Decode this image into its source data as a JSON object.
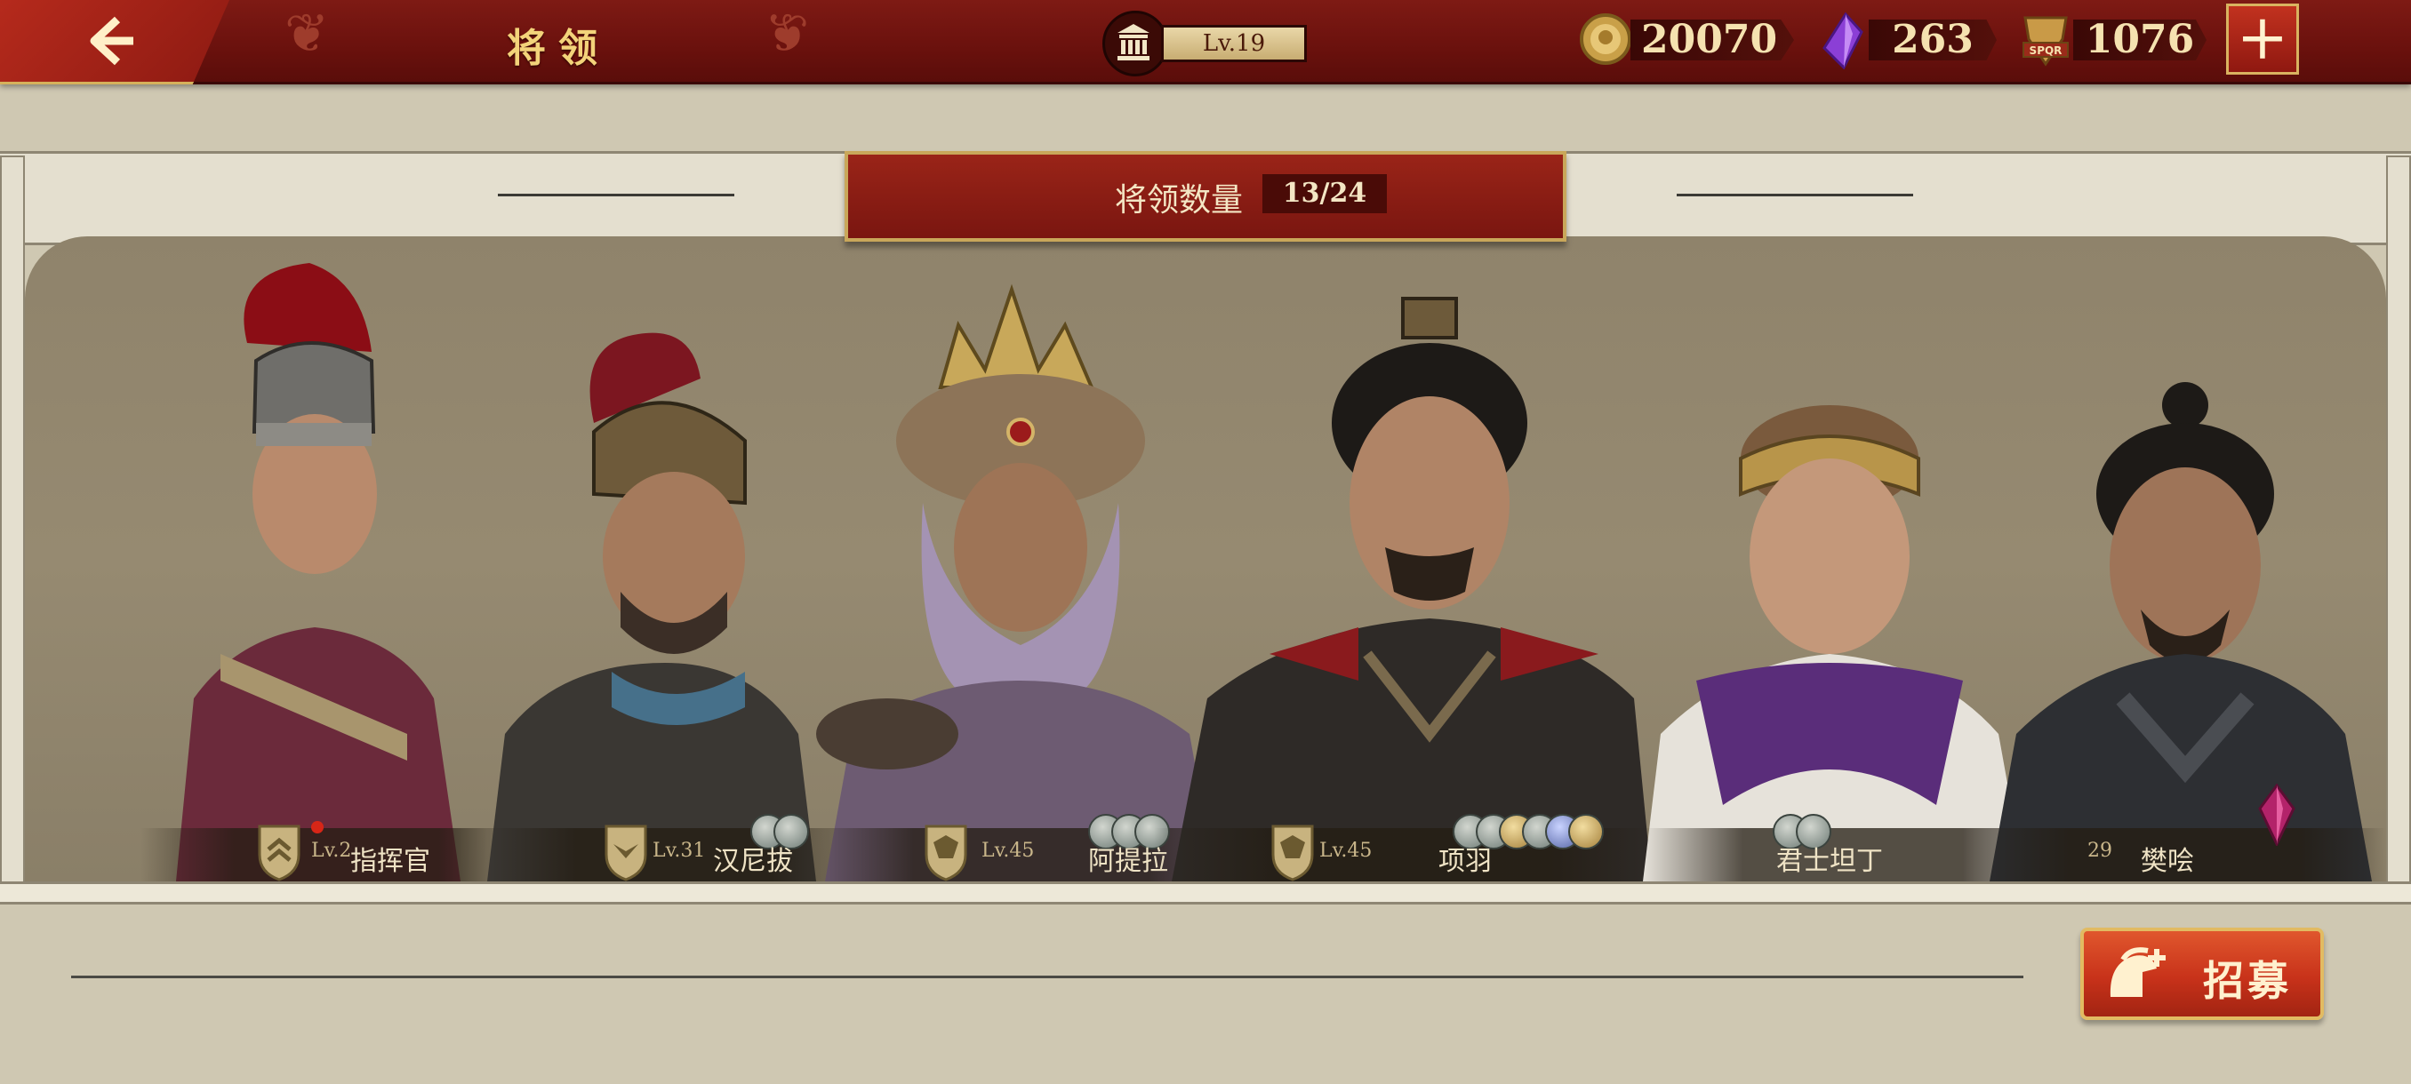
{
  "header": {
    "title": "将领",
    "level": "Lv.19",
    "resources": [
      {
        "name": "gold-coin-icon",
        "value": "20070"
      },
      {
        "name": "purple-gem-icon",
        "value": "263"
      },
      {
        "name": "spqr-token-icon",
        "value": "1076"
      }
    ]
  },
  "banner": {
    "label": "将领数量",
    "count": "13/24"
  },
  "generals": [
    {
      "name": "指挥官",
      "level": "Lv.2",
      "badges": 0,
      "red_dot": true
    },
    {
      "name": "汉尼拔",
      "level": "Lv.31",
      "badges": 2
    },
    {
      "name": "阿提拉",
      "level": "Lv.45",
      "badges": 3
    },
    {
      "name": "项羽",
      "level": "Lv.45",
      "badges": 6
    },
    {
      "name": "君士坦丁",
      "level": "",
      "badges": 2
    },
    {
      "name": "樊哙",
      "level": "29",
      "badges": 0
    }
  ],
  "actions": {
    "recruit": "招募"
  },
  "colors": {
    "topbar": "#6a110d",
    "accent_gold": "#f3d37a",
    "panel_bg": "#968a71"
  }
}
